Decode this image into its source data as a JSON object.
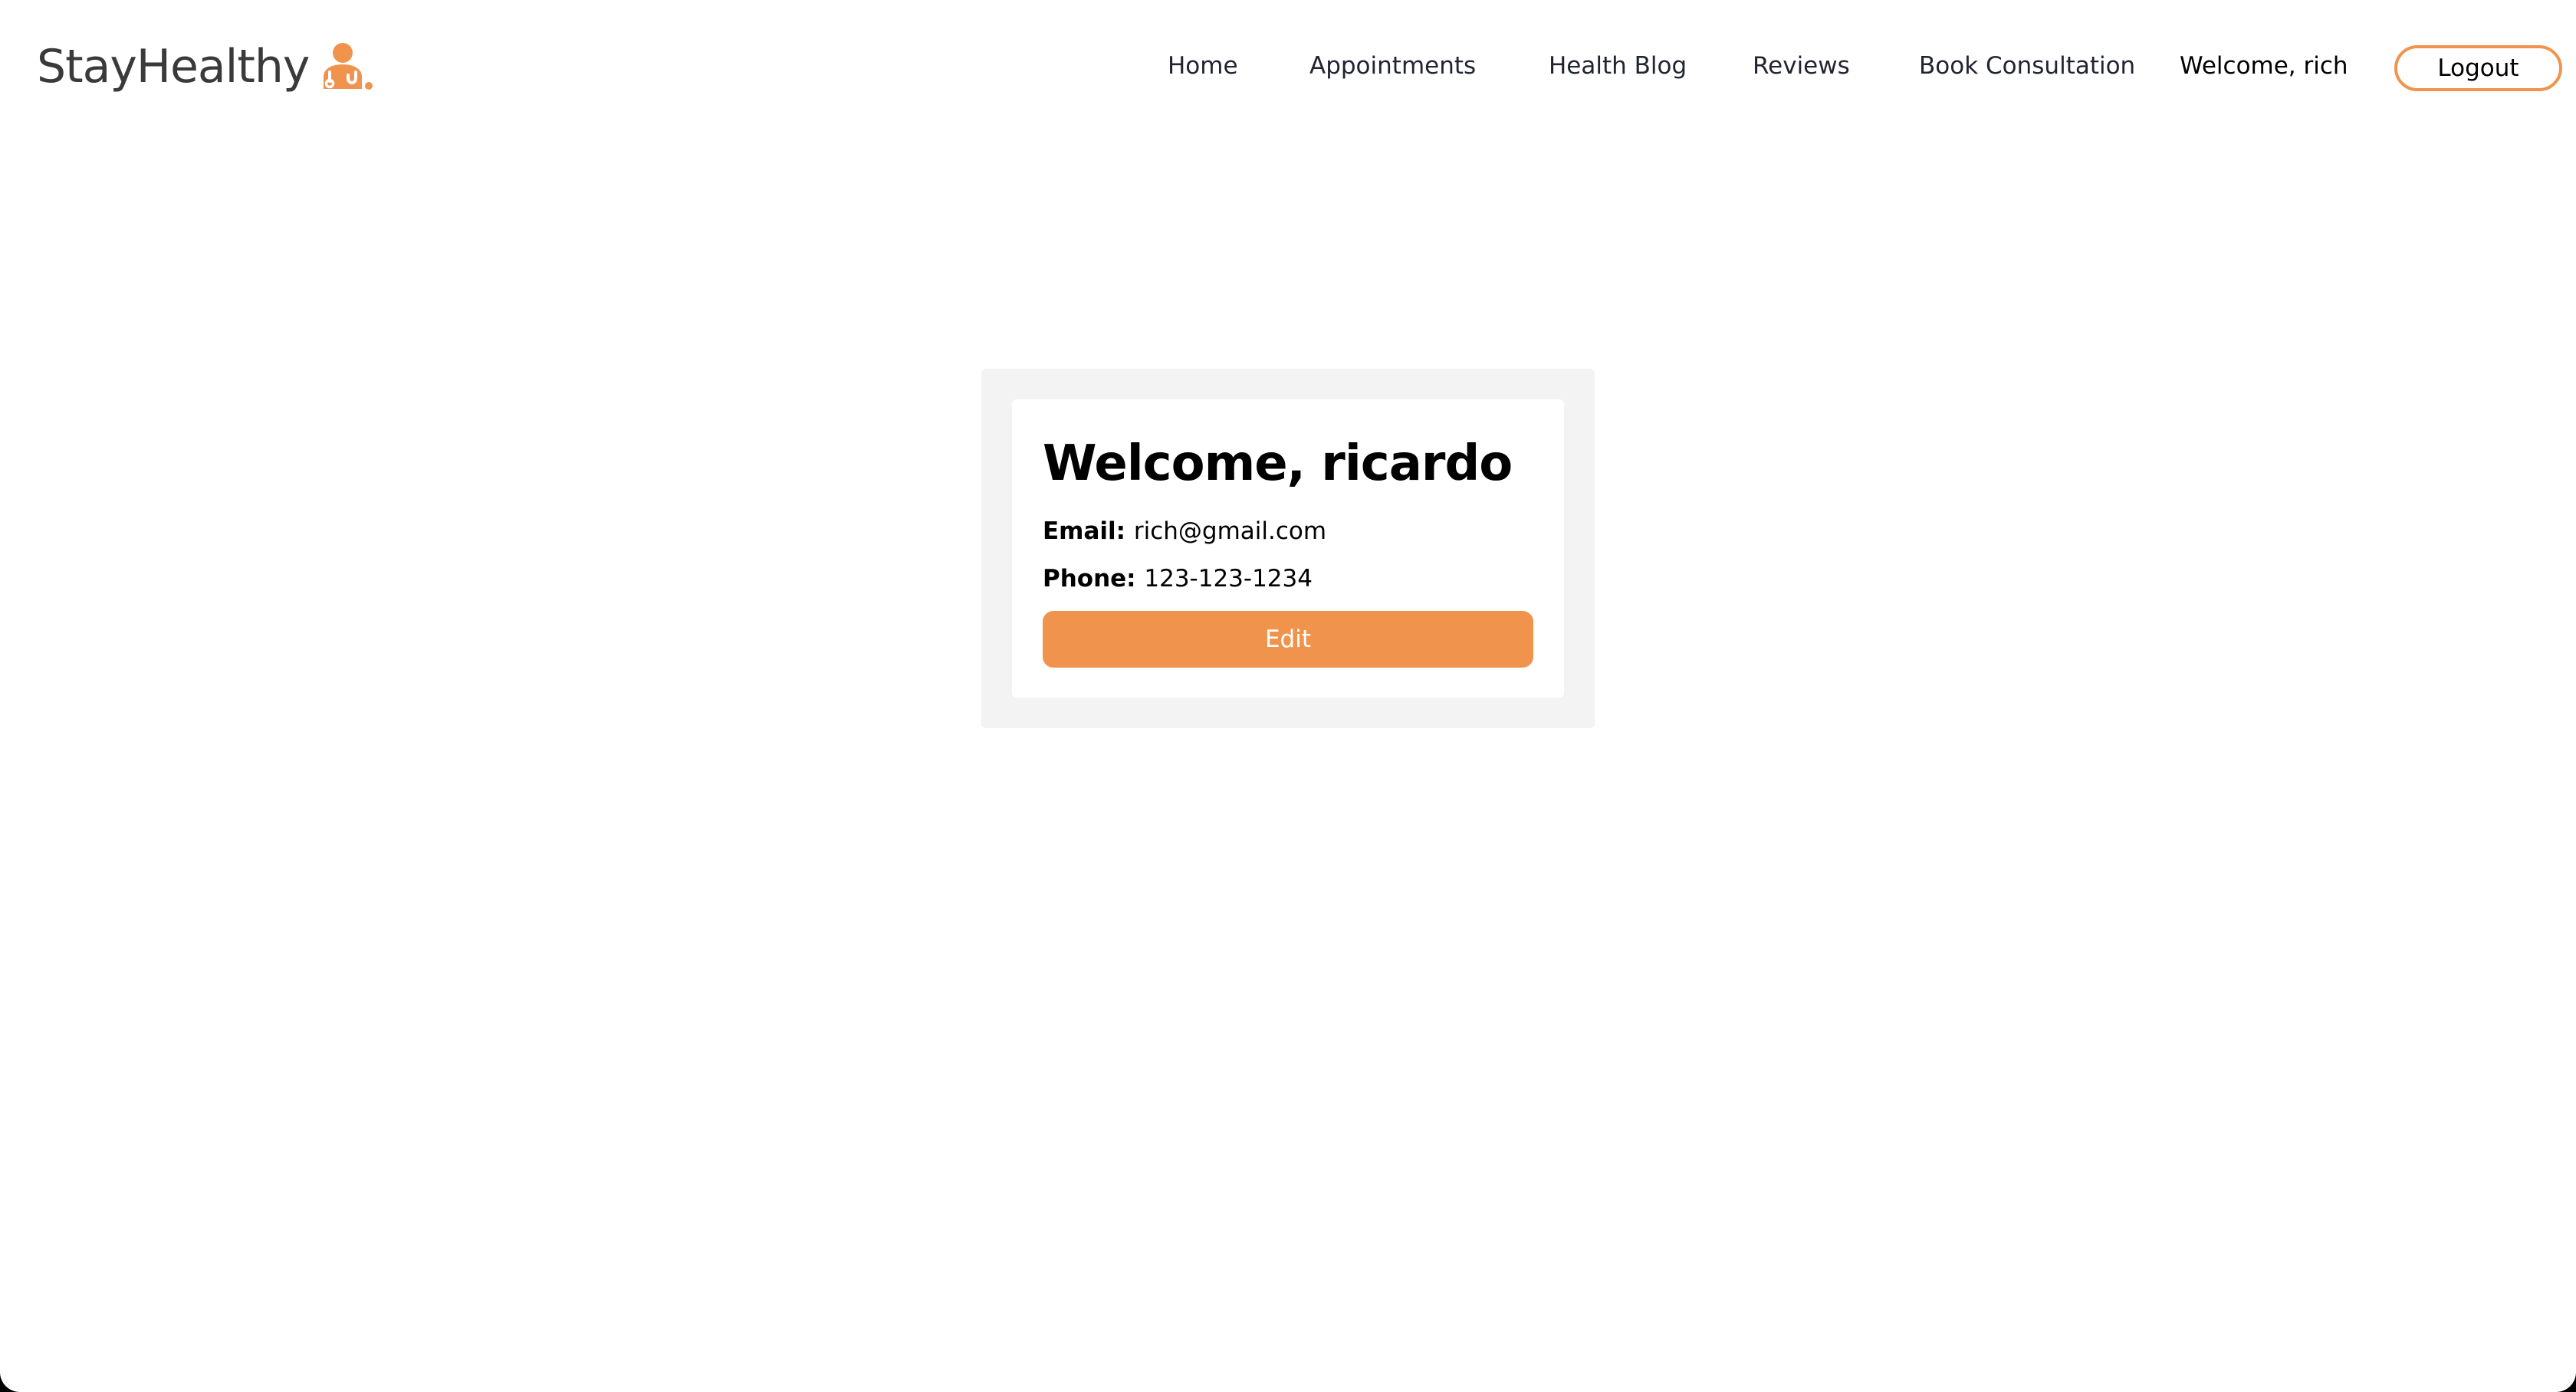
{
  "navbar": {
    "brand": {
      "name": "StayHealthy",
      "icon": "doctor-stethoscope-icon",
      "accent_color": "#f0944d"
    },
    "links": [
      "Home",
      "Appointments",
      "Health Blog",
      "Reviews",
      "Book Consultation"
    ],
    "welcome_text": "Welcome, rich",
    "logout_label": "Logout"
  },
  "profile": {
    "title": "Welcome, ricardo",
    "email_label": "Email:",
    "email_value": "rich@gmail.com",
    "phone_label": "Phone:",
    "phone_value": "123-123-1234",
    "edit_label": "Edit"
  },
  "colors": {
    "accent": "#f0944d",
    "card_outer": "#f3f3f3",
    "card_inner": "#ffffff"
  }
}
